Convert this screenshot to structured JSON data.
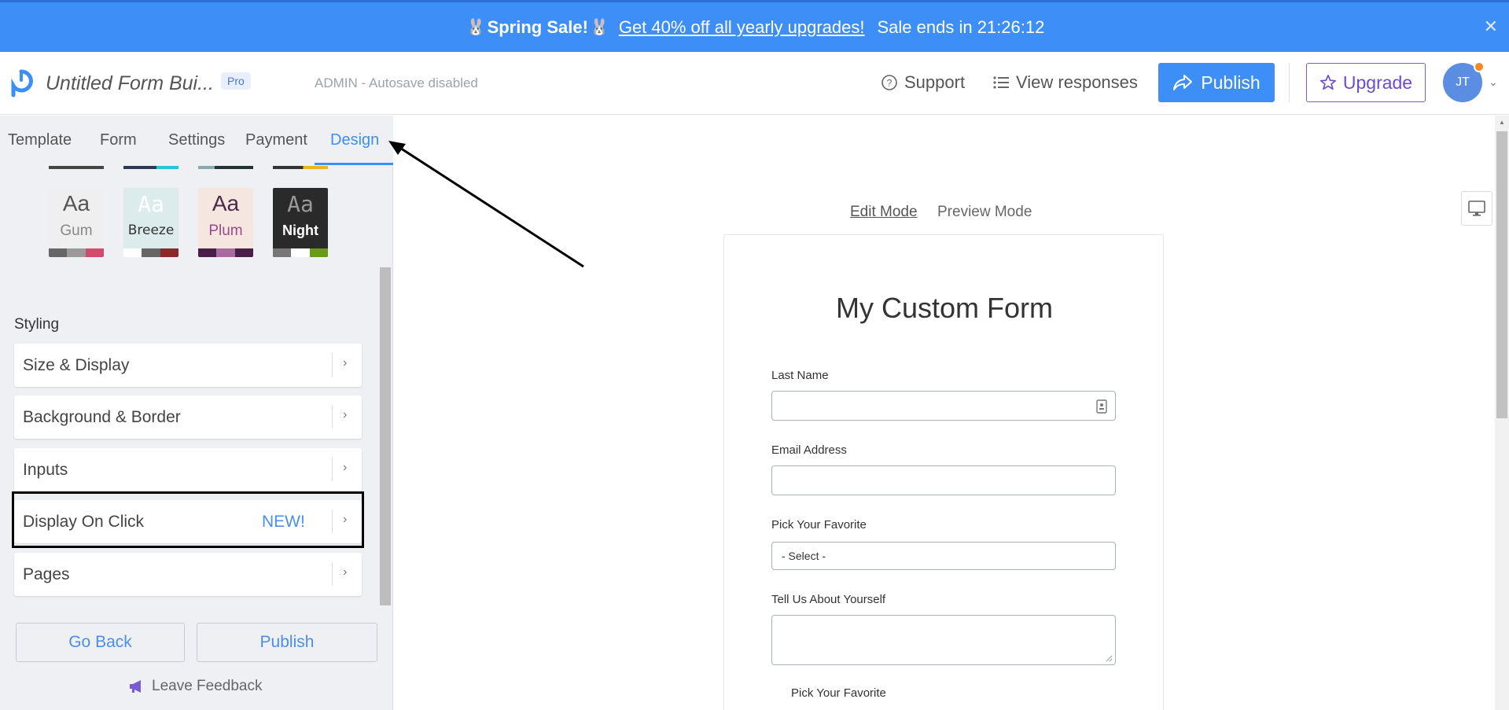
{
  "promo": {
    "bunny_icon": "🐰",
    "title": "Spring Sale!",
    "link_text": "Get 40% off all yearly upgrades!",
    "ends": "Sale ends in 21:26:12",
    "close_icon": "✕"
  },
  "header": {
    "form_title": "Untitled Form Bui...",
    "badge": "Pro",
    "status": "ADMIN - Autosave disabled",
    "support": "Support",
    "view_responses": "View responses",
    "publish": "Publish",
    "upgrade": "Upgrade",
    "avatar_initials": "JT"
  },
  "tabs": [
    "Template",
    "Form",
    "Settings",
    "Payment",
    "Design"
  ],
  "active_tab": "Design",
  "themes": [
    {
      "aa": "Aa",
      "name": "Gum"
    },
    {
      "aa": "Aa",
      "name": "Breeze"
    },
    {
      "aa": "Aa",
      "name": "Plum"
    },
    {
      "aa": "Aa",
      "name": "Night"
    }
  ],
  "styling": {
    "heading": "Styling",
    "items": [
      {
        "label": "Size & Display",
        "badge": ""
      },
      {
        "label": "Background & Border",
        "badge": ""
      },
      {
        "label": "Inputs",
        "badge": ""
      },
      {
        "label": "Display On Click",
        "badge": "NEW!"
      },
      {
        "label": "Pages",
        "badge": ""
      }
    ]
  },
  "footer": {
    "go_back": "Go Back",
    "publish": "Publish",
    "feedback": "Leave Feedback"
  },
  "modes": {
    "edit": "Edit Mode",
    "preview": "Preview Mode"
  },
  "form": {
    "heading": "My Custom Form",
    "fields": [
      {
        "label": "Last Name",
        "type": "text",
        "value": ""
      },
      {
        "label": "Email Address",
        "type": "text",
        "value": ""
      },
      {
        "label": "Pick Your Favorite",
        "type": "select",
        "value": "- Select -"
      },
      {
        "label": "Tell Us About Yourself",
        "type": "textarea",
        "value": ""
      },
      {
        "label": "Pick Your Favorite",
        "type": "radio"
      }
    ]
  },
  "colors": {
    "accent": "#3e8ef7",
    "upgrade": "#6c4bd0",
    "panel_bg": "#eef0f3"
  }
}
